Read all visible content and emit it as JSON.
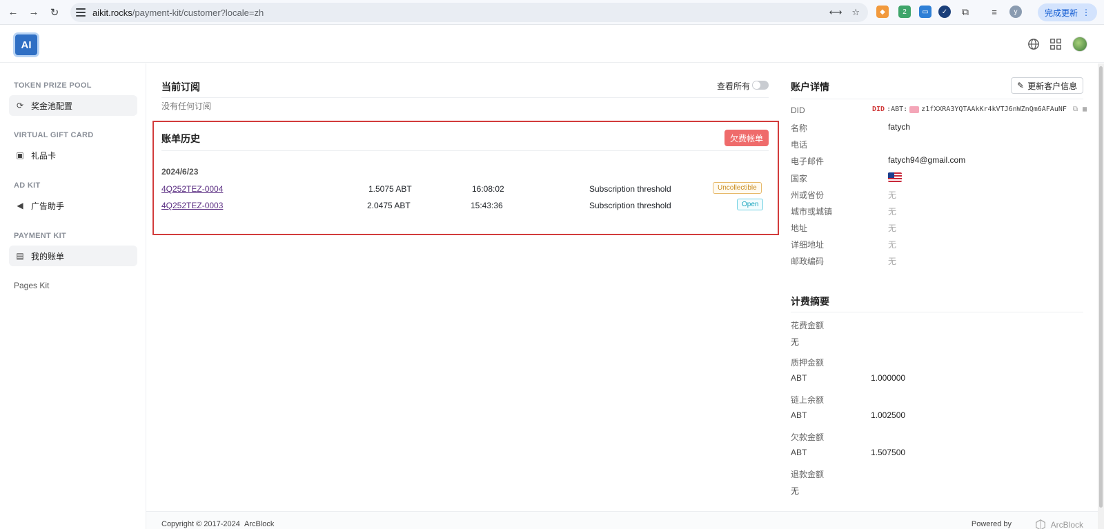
{
  "browser": {
    "url_host": "aikit.rocks",
    "url_path": "/payment-kit/customer?locale=zh",
    "update_label": "完成更新",
    "icons": [
      "back-icon",
      "forward-icon",
      "reload-icon",
      "site-settings-icon",
      "translate-icon",
      "star-icon",
      "metamask-icon",
      "extension-icon",
      "extensions-puzzle-icon",
      "media-icon",
      "profile-icon"
    ]
  },
  "header": {
    "logo_text": "AI",
    "icons": [
      "globe-icon",
      "apps-grid-icon",
      "avatar"
    ]
  },
  "sidebar": {
    "sections": [
      {
        "title": "TOKEN PRIZE POOL",
        "item": "奖金池配置",
        "icon": "refresh-coin-icon",
        "active": true
      },
      {
        "title": "VIRTUAL GIFT CARD",
        "item": "礼品卡",
        "icon": "gift-card-icon",
        "active": false
      },
      {
        "title": "AD KIT",
        "item": "广告助手",
        "icon": "megaphone-icon",
        "active": false
      },
      {
        "title": "PAYMENT KIT",
        "item": "我的账单",
        "icon": "receipt-icon",
        "active": true
      }
    ],
    "plain_item": "Pages Kit"
  },
  "subscription": {
    "title": "当前订阅",
    "toggle_label": "查看所有",
    "empty_text": "没有任何订阅"
  },
  "invoices": {
    "title": "账单历史",
    "overdue_button": "欠费帐单",
    "date": "2024/6/23",
    "rows": [
      {
        "id": "4Q252TEZ-0004",
        "amount": "1.5075 ABT",
        "time": "16:08:02",
        "reason": "Subscription threshold",
        "status": "Uncollectible"
      },
      {
        "id": "4Q252TEZ-0003",
        "amount": "2.0475 ABT",
        "time": "15:43:36",
        "reason": "Subscription threshold",
        "status": "Open"
      }
    ]
  },
  "account": {
    "title": "账户详情",
    "edit_button": "更新客户信息",
    "did_label": "DID",
    "did_prefix": "DID",
    "did_chain": ":ABT:",
    "did_value": "z1fXXRA3YQTAAkKr4kVTJ6nWZnQm6AFAuNF",
    "fields": [
      {
        "label": "名称",
        "value": "fatych"
      },
      {
        "label": "电话",
        "value": ""
      },
      {
        "label": "电子邮件",
        "value": "fatych94@gmail.com"
      },
      {
        "label": "国家",
        "value": ""
      },
      {
        "label": "州或省份",
        "value": "无"
      },
      {
        "label": "城市或城镇",
        "value": "无"
      },
      {
        "label": "地址",
        "value": "无"
      },
      {
        "label": "详细地址",
        "value": "无"
      },
      {
        "label": "邮政编码",
        "value": "无"
      }
    ]
  },
  "billing": {
    "title": "计费摘要",
    "items": [
      {
        "label": "花费金额",
        "currency": "无",
        "amount": ""
      },
      {
        "label": "质押金额",
        "currency": "ABT",
        "amount": "1.000000"
      },
      {
        "label": "链上余额",
        "currency": "ABT",
        "amount": "1.002500"
      },
      {
        "label": "欠款金额",
        "currency": "ABT",
        "amount": "1.507500"
      },
      {
        "label": "退款金额",
        "currency": "无",
        "amount": ""
      }
    ]
  },
  "footer": {
    "copyright": "Copyright © 2017-2024",
    "company": "ArcBlock",
    "powered_by": "Powered by",
    "brand": "ArcBlock"
  }
}
